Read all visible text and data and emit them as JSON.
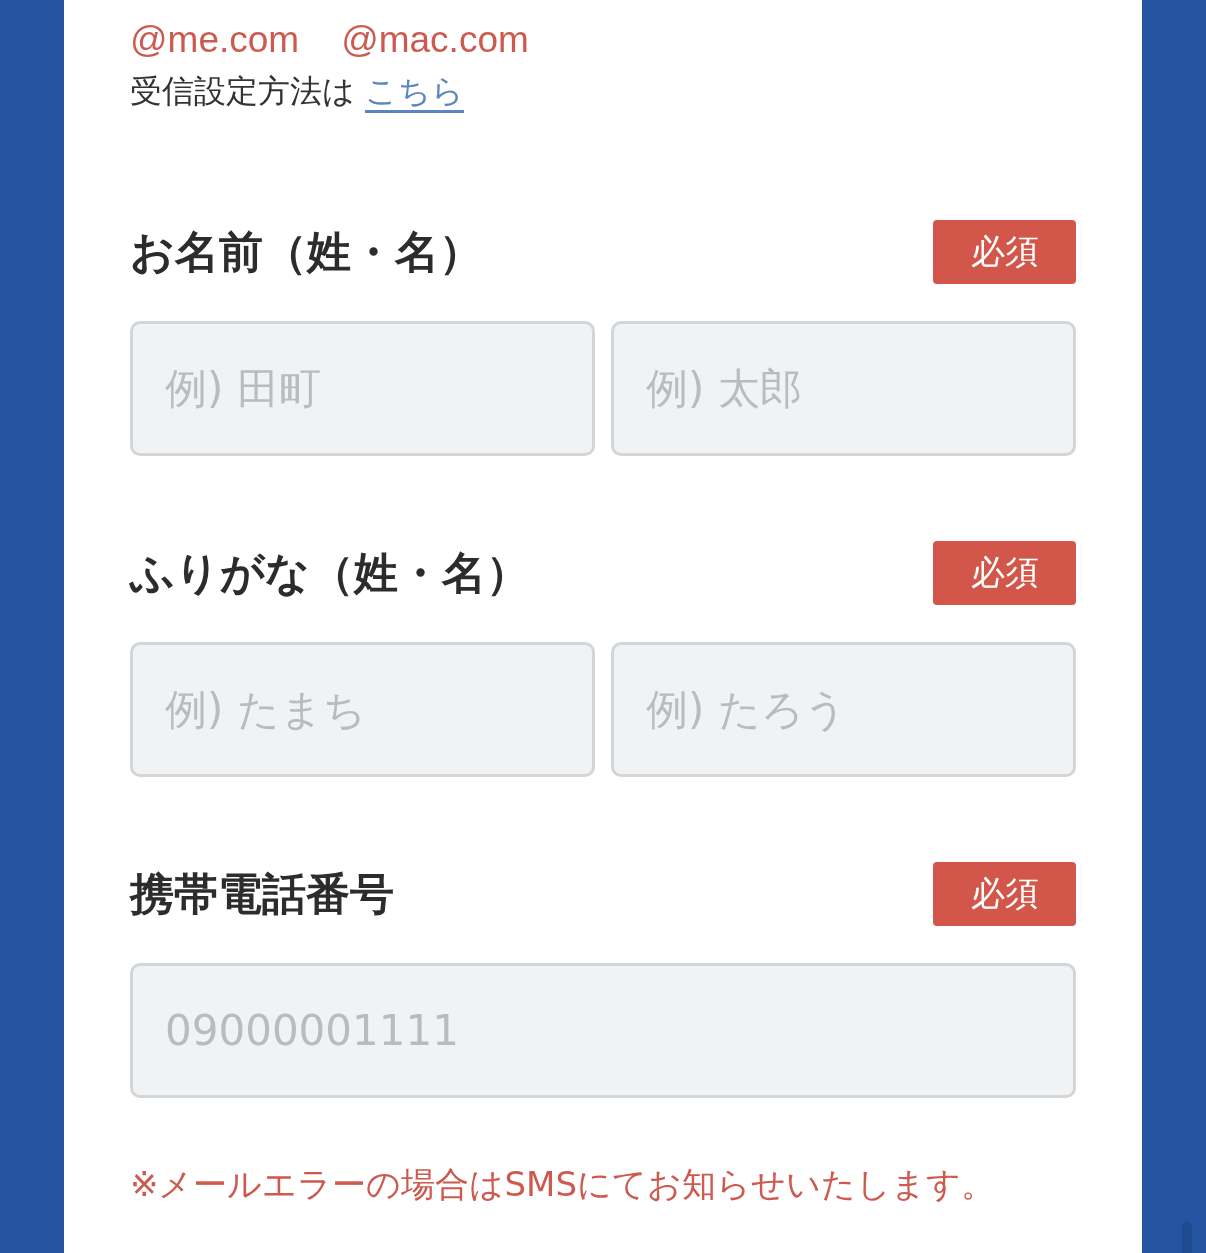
{
  "email_domains": [
    "@me.com",
    "@mac.com"
  ],
  "receive_settings": {
    "text": "受信設定方法は",
    "link": "こちら"
  },
  "fields": [
    {
      "label": "お名前（姓・名）",
      "badge": "必須",
      "inputs": [
        {
          "placeholder": "例) 田町"
        },
        {
          "placeholder": "例) 太郎"
        }
      ]
    },
    {
      "label": "ふりがな（姓・名）",
      "badge": "必須",
      "inputs": [
        {
          "placeholder": "例) たまち"
        },
        {
          "placeholder": "例) たろう"
        }
      ]
    },
    {
      "label": "携帯電話番号",
      "badge": "必須",
      "inputs": [
        {
          "placeholder": "09000001111"
        }
      ]
    }
  ],
  "note": "※メールエラーの場合はSMSにてお知らせいたします。"
}
